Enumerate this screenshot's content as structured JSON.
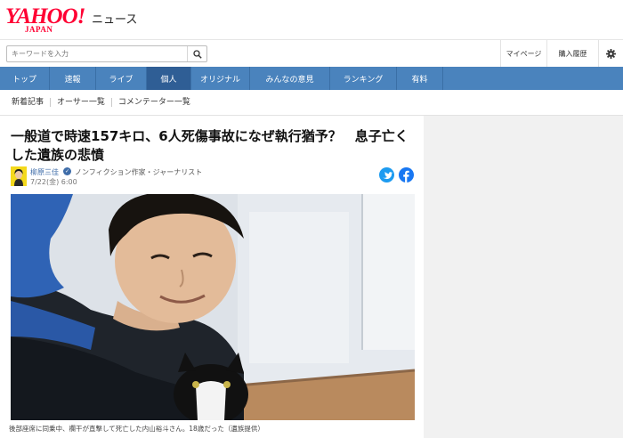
{
  "header": {
    "logo_main": "YAHOO!",
    "logo_sub": "JAPAN",
    "section": "ニュース"
  },
  "search": {
    "placeholder": "キーワードを入力",
    "button_icon": "search-icon"
  },
  "top_links": {
    "mypage": "マイページ",
    "history": "購入履歴",
    "settings_icon": "gear-icon"
  },
  "nav": {
    "items": [
      {
        "label": "トップ"
      },
      {
        "label": "速報"
      },
      {
        "label": "ライブ"
      },
      {
        "label": "個人",
        "active": true
      },
      {
        "label": "オリジナル"
      },
      {
        "label": "みんなの意見"
      },
      {
        "label": "ランキング"
      },
      {
        "label": "有料"
      }
    ]
  },
  "subnav": {
    "items": [
      {
        "label": "新着記事"
      },
      {
        "label": "オーサー一覧"
      },
      {
        "label": "コメンテーター一覧"
      }
    ]
  },
  "article": {
    "headline": "一般道で時速157キロ、6人死傷事故になぜ執行猶予？　息子亡くした遺族の悲憤",
    "author_name": "柳原三佳",
    "author_title": "ノンフィクション作家・ジャーナリスト",
    "pubdate": "7/22(金) 6:00",
    "share_twitter_icon": "twitter-icon",
    "share_facebook_icon": "facebook-icon",
    "photo_caption": "後部座席に同乗中、欄干が直撃して死亡した内山裕斗さん。18歳だった（遺族提供）"
  },
  "colors": {
    "brand_red": "#ff0033",
    "nav_blue": "#4a83bd",
    "nav_active": "#2f5e95",
    "link_blue": "#3f6da9",
    "twitter": "#1d9bf0",
    "facebook": "#1877f2"
  }
}
